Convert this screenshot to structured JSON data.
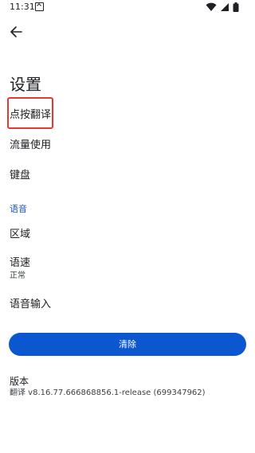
{
  "status_bar": {
    "time": "11:31",
    "icons": [
      "notification-icon",
      "wifi-icon",
      "signal-icon",
      "battery-icon"
    ]
  },
  "app_bar": {
    "back_icon": "arrow-back-icon"
  },
  "page": {
    "title": "设置"
  },
  "settings": {
    "tap_to_translate": {
      "label": "点按翻译"
    },
    "data_usage": {
      "label": "流量使用"
    },
    "keyboard": {
      "label": "键盘"
    }
  },
  "speech_section": {
    "header": "语音",
    "region": {
      "label": "区域"
    },
    "speed": {
      "label": "语速",
      "value": "正常"
    },
    "voice_input": {
      "label": "语音输入"
    }
  },
  "clear_button": {
    "label": "清除"
  },
  "version": {
    "label": "版本",
    "value": "翻译 v8.16.77.666868856.1-release (699347962)"
  },
  "colors": {
    "accent": "#0b57d0",
    "section_header": "#1a56c4",
    "highlight": "#e53935",
    "text": "#202124"
  }
}
